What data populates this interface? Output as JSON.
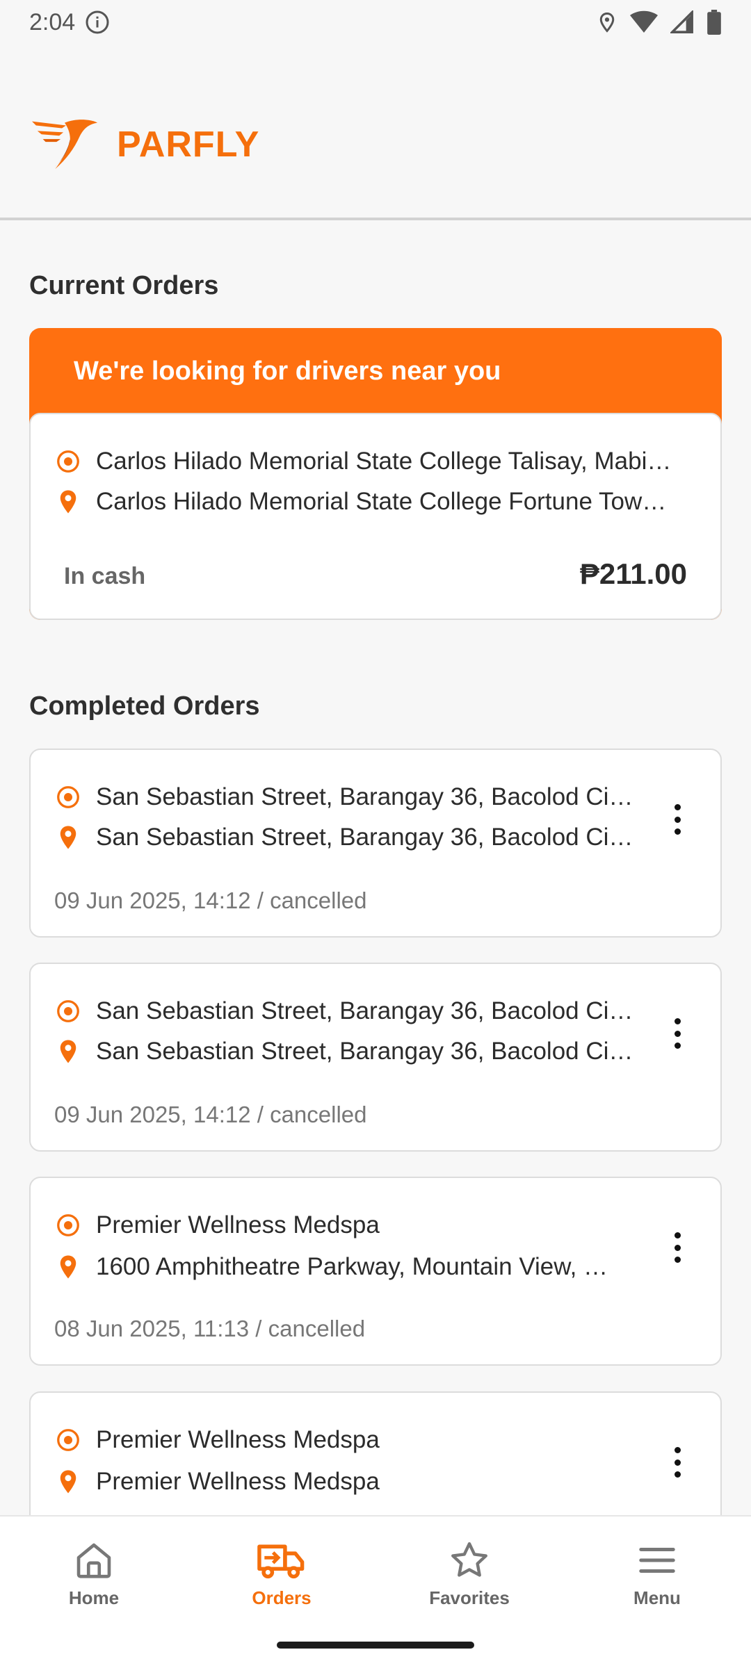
{
  "status_bar": {
    "time": "2:04"
  },
  "brand": {
    "name": "PARFLY",
    "accent": "#f56f0c"
  },
  "current_orders": {
    "title": "Current Orders",
    "banner": "We're looking for drivers near you",
    "pickup": "Carlos Hilado Memorial State College Talisay, Mabi…",
    "dropoff": "Carlos Hilado Memorial State College Fortune Tow…",
    "payment": "In cash",
    "price": "₱211.00"
  },
  "completed_orders": {
    "title": "Completed Orders",
    "items": [
      {
        "pickup": "San Sebastian Street, Barangay 36, Bacolod Ci…",
        "dropoff": "San Sebastian Street, Barangay 36, Bacolod Ci…",
        "meta": "09 Jun 2025, 14:12 / cancelled"
      },
      {
        "pickup": "San Sebastian Street, Barangay 36, Bacolod Ci…",
        "dropoff": "San Sebastian Street, Barangay 36, Bacolod Ci…",
        "meta": "09 Jun 2025, 14:12 / cancelled"
      },
      {
        "pickup": "Premier Wellness Medspa",
        "dropoff": "1600 Amphitheatre Parkway, Mountain View, …",
        "meta": "08 Jun 2025, 11:13 / cancelled"
      },
      {
        "pickup": "Premier Wellness Medspa",
        "dropoff": "Premier Wellness Medspa",
        "meta": ""
      }
    ]
  },
  "nav": {
    "items": [
      {
        "label": "Home",
        "icon": "home-icon"
      },
      {
        "label": "Orders",
        "icon": "truck-icon",
        "active": true
      },
      {
        "label": "Favorites",
        "icon": "star-icon"
      },
      {
        "label": "Menu",
        "icon": "menu-icon"
      }
    ]
  }
}
